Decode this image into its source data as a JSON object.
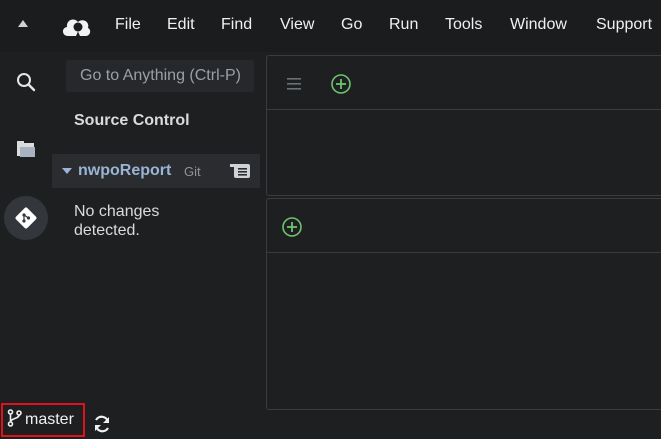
{
  "menubar": {
    "items": [
      "File",
      "Edit",
      "Find",
      "View",
      "Go",
      "Run",
      "Tools",
      "Window",
      "Support"
    ]
  },
  "sidebar": {
    "search_placeholder": "Go to Anything (Ctrl-P)",
    "title": "Source Control",
    "repo": {
      "name": "nwpoReport",
      "vcs": "Git"
    },
    "empty_message_line1": "No changes",
    "empty_message_line2": "detected."
  },
  "statusbar": {
    "branch": "master"
  },
  "colors": {
    "accent_green": "#6fc26f",
    "highlight_red": "#e0131b",
    "repo_blue": "#9ab4d6"
  }
}
